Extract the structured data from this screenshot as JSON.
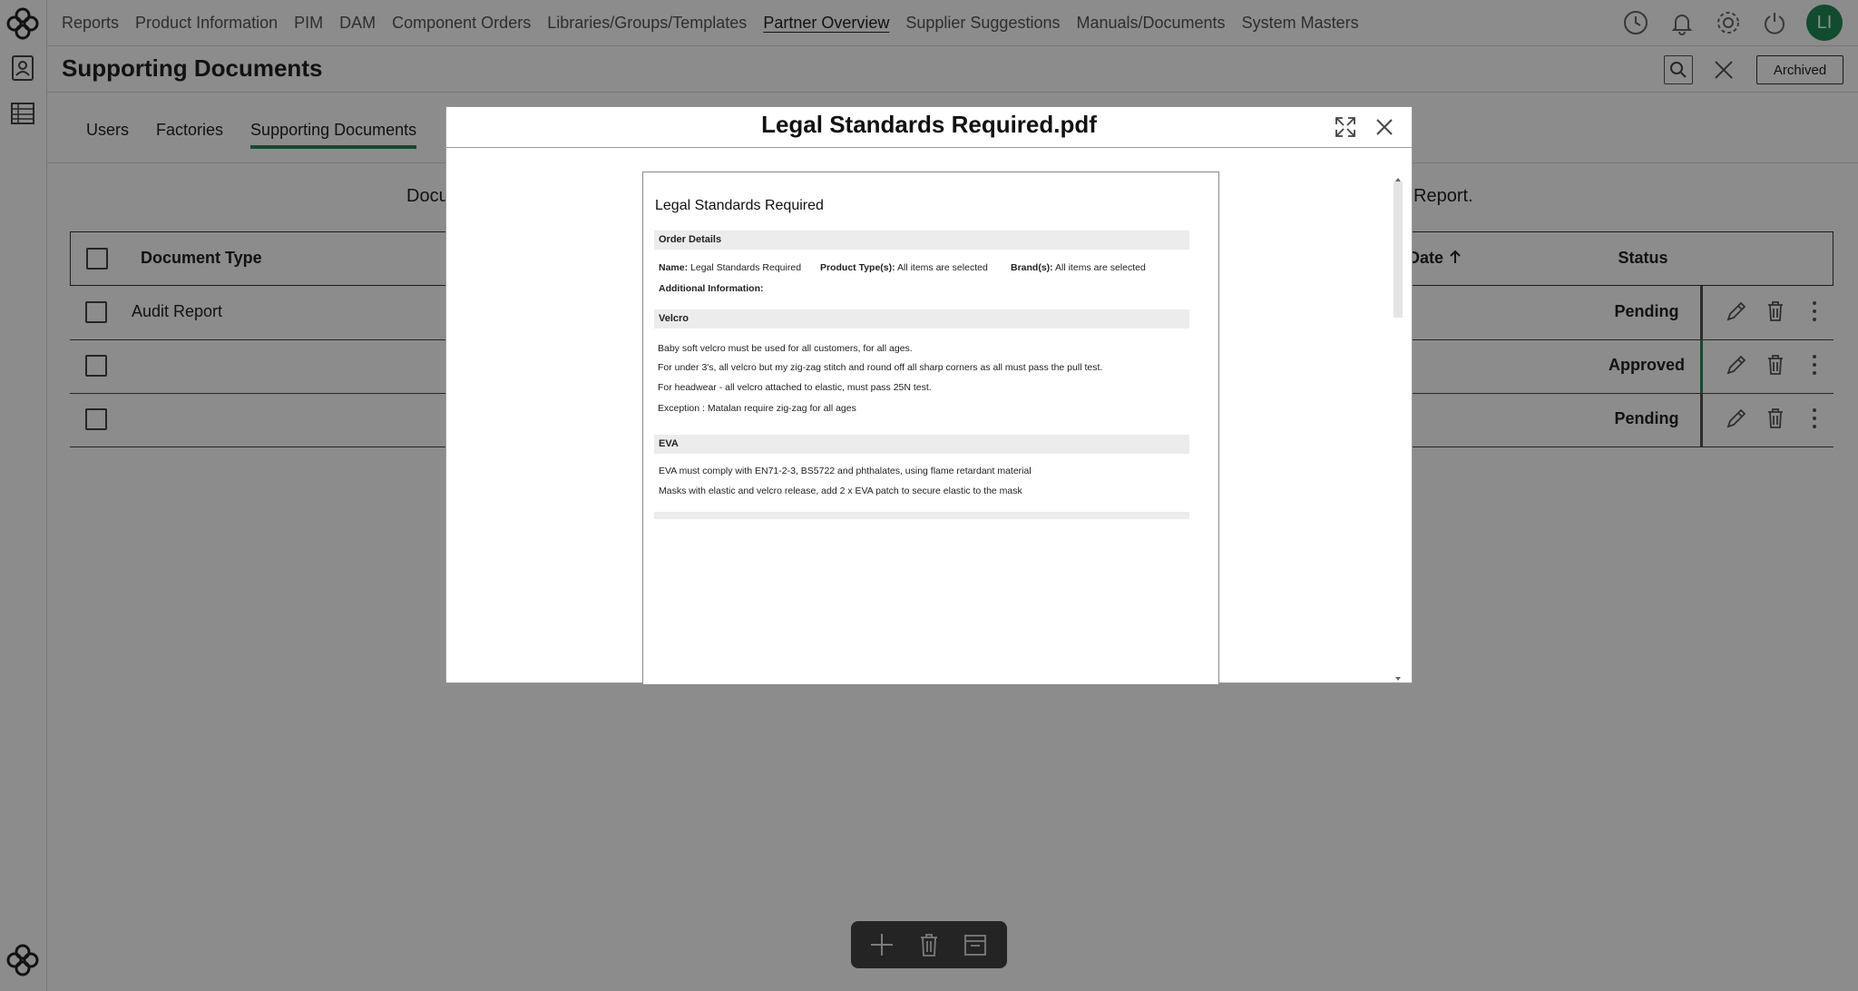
{
  "nav": {
    "items": [
      "Reports",
      "Product Information",
      "PIM",
      "DAM",
      "Component Orders",
      "Libraries/Groups/Templates",
      "Partner Overview",
      "Supplier Suggestions",
      "Manuals/Documents",
      "System Masters"
    ],
    "active": "Partner Overview",
    "avatar_initials": "LI",
    "icons": [
      "history-icon",
      "bell-icon",
      "gear-icon",
      "power-icon"
    ]
  },
  "header": {
    "title": "Supporting Documents",
    "archived_label": "Archived"
  },
  "tabs": [
    "Users",
    "Factories",
    "Supporting Documents"
  ],
  "active_tab": "Supporting Documents",
  "subtitle": {
    "left_fragment": "Docu",
    "right_fragment": "Report."
  },
  "table": {
    "col_document_type": "Document Type",
    "col_date": "Date",
    "col_status": "Status",
    "rows": [
      {
        "document_type": "Audit Report",
        "status": "Pending"
      },
      {
        "document_type": "",
        "status": "Approved"
      },
      {
        "document_type": "",
        "status": "Pending"
      }
    ]
  },
  "modal": {
    "title": "Legal Standards Required.pdf",
    "doc": {
      "title": "Legal Standards Required",
      "section_order": "Order Details",
      "name_label": "Name:",
      "name_value": "Legal Standards Required",
      "ptype_label": "Product Type(s):",
      "ptype_value": "All items are selected",
      "brand_label": "Brand(s):",
      "brand_value": "All items are selected",
      "addinfo_label": "Additional Information:",
      "section_velcro": "Velcro",
      "velcro_lines": [
        "Baby soft velcro must be used for all customers, for all ages.",
        "For under 3's, all velcro but my zig-zag stitch and round off all sharp corners as all must pass the pull test.",
        "For headwear - all velcro attached to elastic, must pass 25N test.",
        "Exception : Matalan require zig-zag for all ages"
      ],
      "section_eva": "EVA",
      "eva_lines": [
        "EVA must comply with EN71-2-3, BS5722 and phthalates, using flame retardant material",
        "Masks with elastic and velcro release, add 2 x EVA patch to secure elastic to the mask"
      ]
    }
  },
  "colors": {
    "accent_green": "#1f8a55",
    "overlay": "rgba(0,0,0,0.45)"
  }
}
